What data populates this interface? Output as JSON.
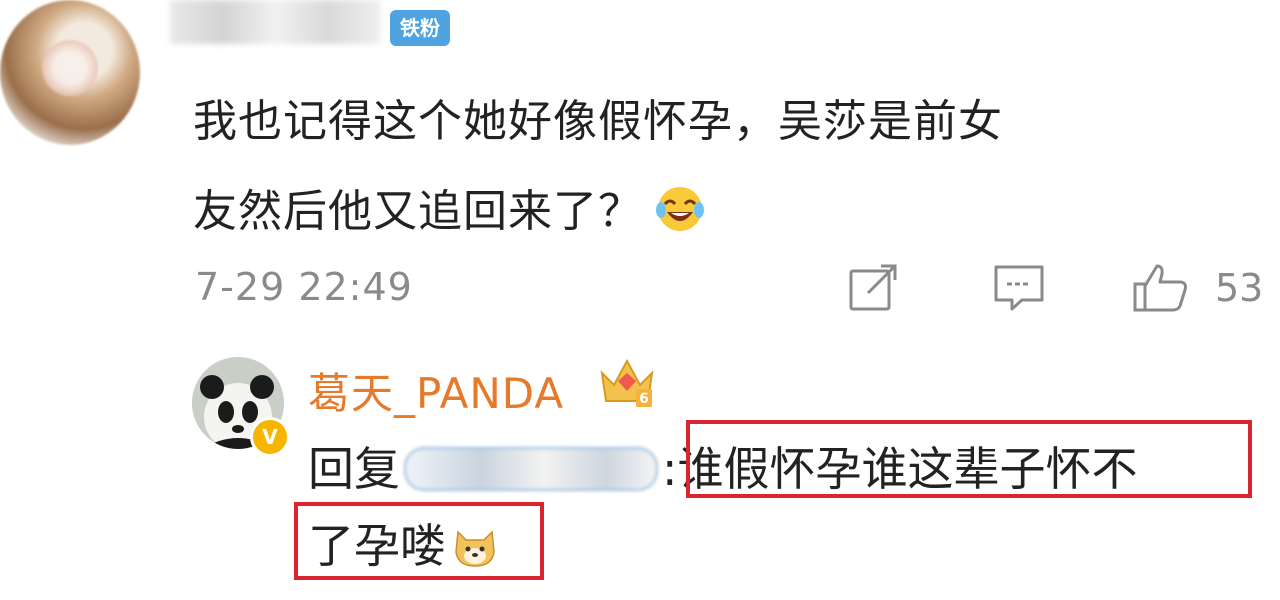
{
  "comment": {
    "badge": "铁粉",
    "text_line1": "我也记得这个她好像假怀孕，吴莎是前女",
    "text_line2": "友然后他又追回来了？",
    "timestamp": "7-29 22:49",
    "like_count": "53",
    "icons": [
      "share-icon",
      "comment-icon",
      "like-icon",
      "laughing-tears-emoji"
    ]
  },
  "reply": {
    "author": "葛天_PANDA",
    "prefix": "回复",
    "colon": ":",
    "text_part1": "谁假怀孕谁这辈子怀不",
    "text_part2": "了孕喽",
    "vip_badge": "V",
    "crown_level": "6",
    "icons": [
      "crown-icon",
      "doge-emoji",
      "verified-badge-icon"
    ]
  },
  "colors": {
    "username_orange": "#e57a2a",
    "badge_blue": "#4fa3e0",
    "highlight_red": "#d7262f",
    "meta_gray": "#8a8a8a"
  }
}
